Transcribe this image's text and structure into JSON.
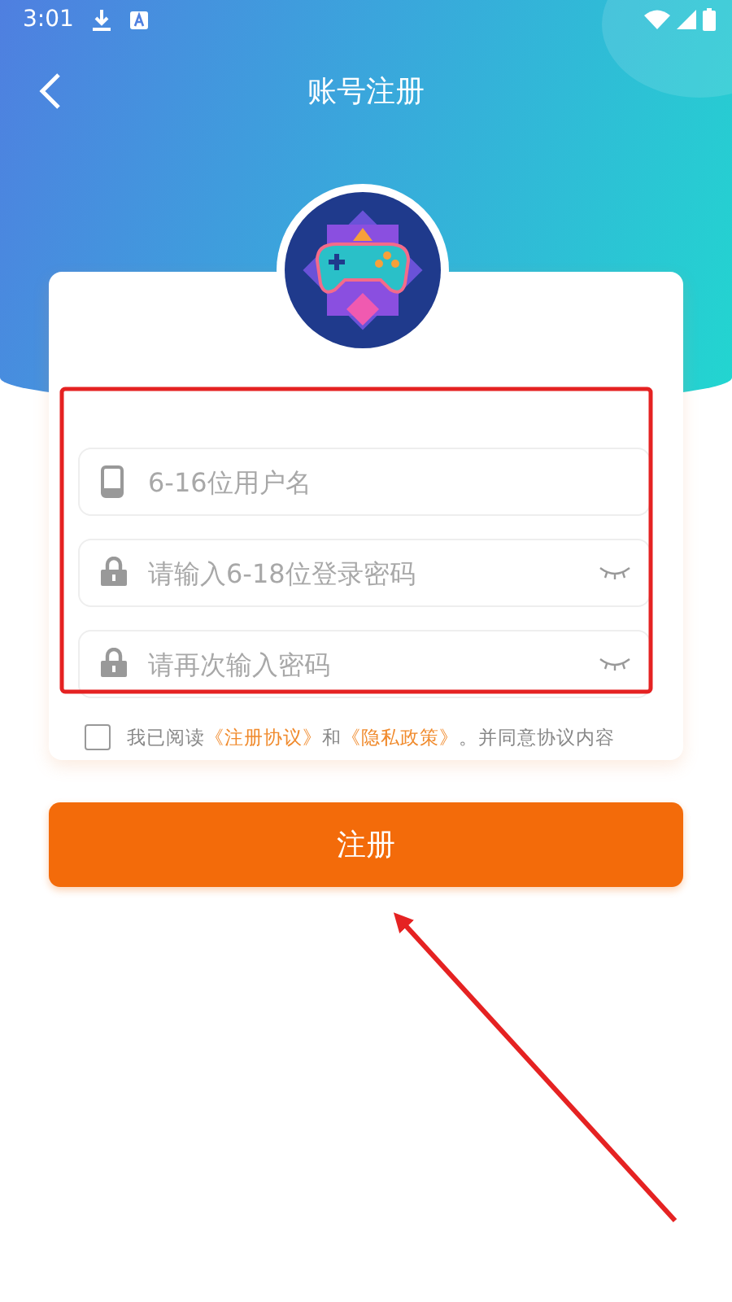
{
  "status_bar": {
    "time": "3:01"
  },
  "header": {
    "title": "账号注册"
  },
  "fields": [
    {
      "kind": "username",
      "placeholder": "6-16位用户名"
    },
    {
      "kind": "password",
      "placeholder": "请输入6-18位登录密码"
    },
    {
      "kind": "password",
      "placeholder": "请再次输入密码"
    }
  ],
  "agreement": {
    "checked": false,
    "parts": [
      {
        "kind": "plain",
        "text": "我已阅读"
      },
      {
        "kind": "link",
        "text": "《注册协议》"
      },
      {
        "kind": "plain",
        "text": "和"
      },
      {
        "kind": "link",
        "text": "《隐私政策》"
      },
      {
        "kind": "plain",
        "text": "。并同意协议内容"
      }
    ]
  },
  "register_button": {
    "label": "注册"
  }
}
